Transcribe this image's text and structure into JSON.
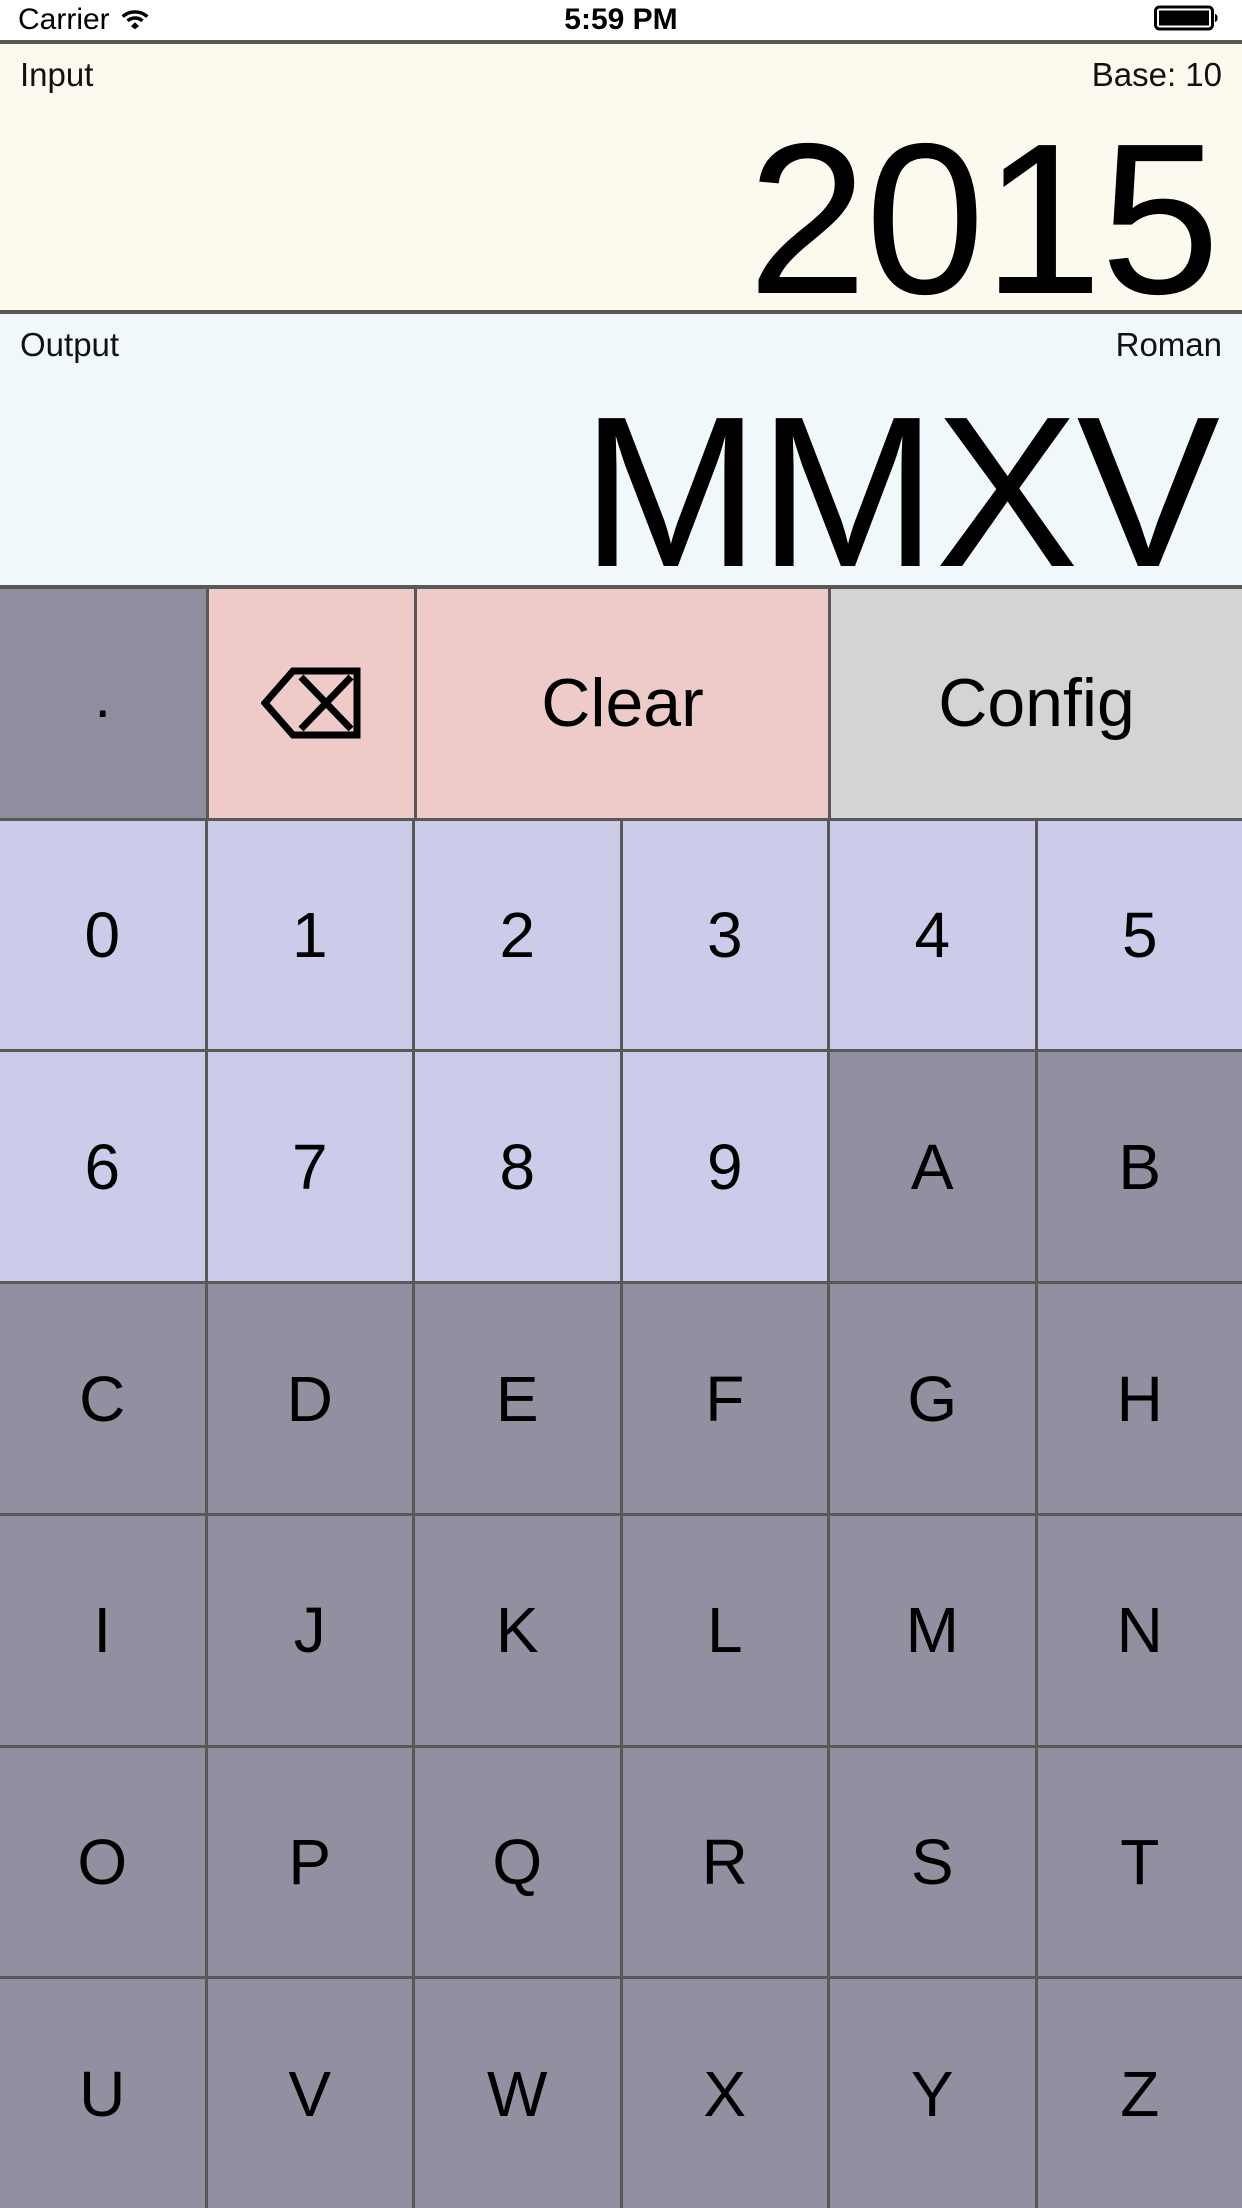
{
  "statusbar": {
    "carrier": "Carrier",
    "wifi_icon": "wifi-icon",
    "time": "5:59 PM",
    "battery_icon": "battery-full-icon"
  },
  "input_panel": {
    "label": "Input",
    "base_label": "Base: 10",
    "value": "2015"
  },
  "output_panel": {
    "label": "Output",
    "format_label": "Roman",
    "value": "MMXV"
  },
  "keypad": {
    "rows": [
      {
        "keys": [
          {
            "label": ".",
            "style": "k-dot",
            "kind": "text",
            "name": "key-decimal-point",
            "enabled": true
          },
          {
            "label": "⌫",
            "style": "k-pink",
            "kind": "icon",
            "name": "backspace-icon",
            "enabled": true
          },
          {
            "label": "Clear",
            "style": "k-pink",
            "kind": "word",
            "name": "clear-button",
            "enabled": true,
            "span": 2
          },
          {
            "label": "Config",
            "style": "k-gray",
            "kind": "word",
            "name": "config-button",
            "enabled": true,
            "span": 2
          }
        ]
      },
      {
        "keys": [
          {
            "label": "0",
            "style": "k-enabled",
            "kind": "text",
            "name": "key-0",
            "enabled": true
          },
          {
            "label": "1",
            "style": "k-enabled",
            "kind": "text",
            "name": "key-1",
            "enabled": true
          },
          {
            "label": "2",
            "style": "k-enabled",
            "kind": "text",
            "name": "key-2",
            "enabled": true
          },
          {
            "label": "3",
            "style": "k-enabled",
            "kind": "text",
            "name": "key-3",
            "enabled": true
          },
          {
            "label": "4",
            "style": "k-enabled",
            "kind": "text",
            "name": "key-4",
            "enabled": true
          },
          {
            "label": "5",
            "style": "k-enabled",
            "kind": "text",
            "name": "key-5",
            "enabled": true
          }
        ]
      },
      {
        "keys": [
          {
            "label": "6",
            "style": "k-enabled",
            "kind": "text",
            "name": "key-6",
            "enabled": true
          },
          {
            "label": "7",
            "style": "k-enabled",
            "kind": "text",
            "name": "key-7",
            "enabled": true
          },
          {
            "label": "8",
            "style": "k-enabled",
            "kind": "text",
            "name": "key-8",
            "enabled": true
          },
          {
            "label": "9",
            "style": "k-enabled",
            "kind": "text",
            "name": "key-9",
            "enabled": true
          },
          {
            "label": "A",
            "style": "k-disabled",
            "kind": "text",
            "name": "key-a",
            "enabled": false
          },
          {
            "label": "B",
            "style": "k-disabled",
            "kind": "text",
            "name": "key-b",
            "enabled": false
          }
        ]
      },
      {
        "keys": [
          {
            "label": "C",
            "style": "k-disabled",
            "kind": "text",
            "name": "key-c",
            "enabled": false
          },
          {
            "label": "D",
            "style": "k-disabled",
            "kind": "text",
            "name": "key-d",
            "enabled": false
          },
          {
            "label": "E",
            "style": "k-disabled",
            "kind": "text",
            "name": "key-e",
            "enabled": false
          },
          {
            "label": "F",
            "style": "k-disabled",
            "kind": "text",
            "name": "key-f",
            "enabled": false
          },
          {
            "label": "G",
            "style": "k-disabled",
            "kind": "text",
            "name": "key-g",
            "enabled": false
          },
          {
            "label": "H",
            "style": "k-disabled",
            "kind": "text",
            "name": "key-h",
            "enabled": false
          }
        ]
      },
      {
        "keys": [
          {
            "label": "I",
            "style": "k-disabled",
            "kind": "text",
            "name": "key-i",
            "enabled": false
          },
          {
            "label": "J",
            "style": "k-disabled",
            "kind": "text",
            "name": "key-j",
            "enabled": false
          },
          {
            "label": "K",
            "style": "k-disabled",
            "kind": "text",
            "name": "key-k",
            "enabled": false
          },
          {
            "label": "L",
            "style": "k-disabled",
            "kind": "text",
            "name": "key-l",
            "enabled": false
          },
          {
            "label": "M",
            "style": "k-disabled",
            "kind": "text",
            "name": "key-m",
            "enabled": false
          },
          {
            "label": "N",
            "style": "k-disabled",
            "kind": "text",
            "name": "key-n",
            "enabled": false
          }
        ]
      },
      {
        "keys": [
          {
            "label": "O",
            "style": "k-disabled",
            "kind": "text",
            "name": "key-o",
            "enabled": false
          },
          {
            "label": "P",
            "style": "k-disabled",
            "kind": "text",
            "name": "key-p",
            "enabled": false
          },
          {
            "label": "Q",
            "style": "k-disabled",
            "kind": "text",
            "name": "key-q",
            "enabled": false
          },
          {
            "label": "R",
            "style": "k-disabled",
            "kind": "text",
            "name": "key-r",
            "enabled": false
          },
          {
            "label": "S",
            "style": "k-disabled",
            "kind": "text",
            "name": "key-s",
            "enabled": false
          },
          {
            "label": "T",
            "style": "k-disabled",
            "kind": "text",
            "name": "key-t",
            "enabled": false
          }
        ]
      },
      {
        "keys": [
          {
            "label": "U",
            "style": "k-disabled",
            "kind": "text",
            "name": "key-u",
            "enabled": false
          },
          {
            "label": "V",
            "style": "k-disabled",
            "kind": "text",
            "name": "key-v",
            "enabled": false
          },
          {
            "label": "W",
            "style": "k-disabled",
            "kind": "text",
            "name": "key-w",
            "enabled": false
          },
          {
            "label": "X",
            "style": "k-disabled",
            "kind": "text",
            "name": "key-x",
            "enabled": false
          },
          {
            "label": "Y",
            "style": "k-disabled",
            "kind": "text",
            "name": "key-y",
            "enabled": false
          },
          {
            "label": "Z",
            "style": "k-disabled",
            "kind": "text",
            "name": "key-z",
            "enabled": false
          }
        ]
      }
    ]
  },
  "colors": {
    "input_bg": "#fcf9ef",
    "output_bg": "#f0f8fb",
    "key_enabled": "#ccccea",
    "key_disabled": "#9090a0",
    "key_clear": "#eecbc9",
    "key_config": "#d4d4d4",
    "grid_line": "#585858"
  }
}
